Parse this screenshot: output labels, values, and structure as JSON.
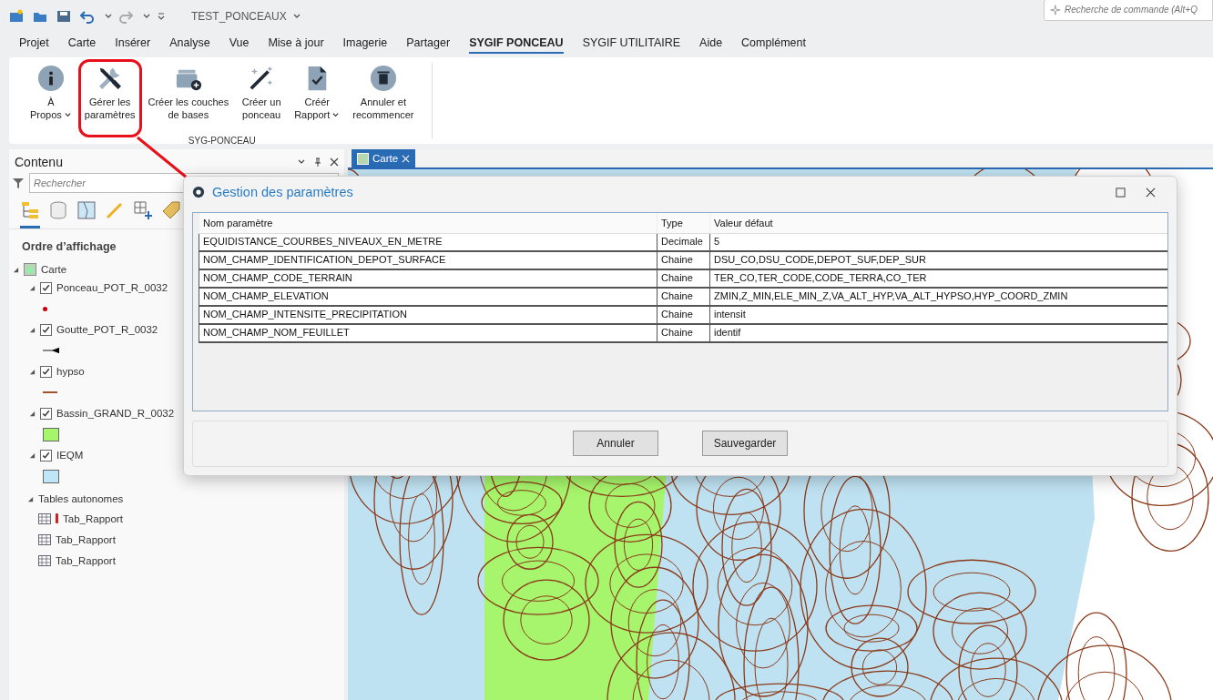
{
  "quick_access": {
    "project_title": "TEST_PONCEAUX",
    "command_search": {
      "placeholder": "Recherche de commande (Alt+Q"
    }
  },
  "menu_tabs": [
    {
      "label": "Projet",
      "selected": false
    },
    {
      "label": "Carte",
      "selected": false
    },
    {
      "label": "Insérer",
      "selected": false
    },
    {
      "label": "Analyse",
      "selected": false
    },
    {
      "label": "Vue",
      "selected": false
    },
    {
      "label": "Mise à jour",
      "selected": false
    },
    {
      "label": "Imagerie",
      "selected": false
    },
    {
      "label": "Partager",
      "selected": false
    },
    {
      "label": "SYGIF PONCEAU",
      "selected": true
    },
    {
      "label": "SYGIF UTILITAIRE",
      "selected": false
    },
    {
      "label": "Aide",
      "selected": false
    },
    {
      "label": "Complément",
      "selected": false
    }
  ],
  "ribbon": {
    "group_label": "SYG-PONCEAU",
    "buttons": [
      {
        "kind": "info",
        "lines": [
          "À",
          "Propos"
        ],
        "dropdown": true,
        "highlighted": false
      },
      {
        "kind": "tools",
        "lines": [
          "Gérer les",
          "paramètres"
        ],
        "dropdown": false,
        "highlighted": true
      },
      {
        "kind": "layers",
        "lines": [
          "Créer les couches",
          "de bases"
        ],
        "dropdown": false,
        "highlighted": false
      },
      {
        "kind": "wand",
        "lines": [
          "Créer un",
          "ponceau"
        ],
        "dropdown": false,
        "highlighted": false
      },
      {
        "kind": "report",
        "lines": [
          "Créér",
          "Rapport"
        ],
        "dropdown": true,
        "highlighted": false
      },
      {
        "kind": "trash",
        "lines": [
          "Annuler et",
          "recommencer"
        ],
        "dropdown": false,
        "highlighted": false
      }
    ]
  },
  "contents_pane": {
    "title": "Contenu",
    "search": {
      "placeholder": "Rechercher"
    },
    "section": "Ordre d’affichage",
    "map": {
      "label": "Carte",
      "expanded": true,
      "children": [
        {
          "label": "Ponceau_POT_R_0032",
          "checked": true,
          "expanded": true,
          "kind": "point",
          "color": "#cc0000"
        },
        {
          "label": "Goutte_POT_R_0032",
          "checked": true,
          "expanded": true,
          "kind": "arrow",
          "color": "#000000"
        },
        {
          "label": "hypso",
          "checked": true,
          "expanded": true,
          "kind": "line",
          "color": "#a0522d"
        },
        {
          "label": "Bassin_GRAND_R_0032",
          "checked": true,
          "expanded": true,
          "kind": "fill",
          "color": "#a6f56c"
        },
        {
          "label": "IEQM",
          "checked": true,
          "expanded": true,
          "kind": "fill",
          "color": "#bfe6f7"
        }
      ]
    },
    "tables": {
      "label": "Tables autonomes",
      "expanded": true,
      "children": [
        {
          "label": "Tab_Rapport",
          "warning": true
        },
        {
          "label": "Tab_Rapport",
          "warning": false
        },
        {
          "label": "Tab_Rapport",
          "warning": false
        }
      ]
    }
  },
  "map_view": {
    "tab": {
      "label": "Carte",
      "selected": true
    }
  },
  "dialog": {
    "title": "Gestion des paramètres",
    "columns": [
      "Nom paramètre",
      "Type",
      "Valeur défaut"
    ],
    "rows": [
      [
        "EQUIDISTANCE_COURBES_NIVEAUX_EN_METRE",
        "Decimale",
        "5"
      ],
      [
        "NOM_CHAMP_IDENTIFICATION_DEPOT_SURFACE",
        "Chaine",
        "DSU_CO,DSU_CODE,DEPOT_SUF,DEP_SUR"
      ],
      [
        "NOM_CHAMP_CODE_TERRAIN",
        "Chaine",
        "TER_CO,TER_CODE,CODE_TERRA,CO_TER"
      ],
      [
        "NOM_CHAMP_ELEVATION",
        "Chaine",
        "ZMIN,Z_MIN,ELE_MIN_Z,VA_ALT_HYP,VA_ALT_HYPSO,HYP_COORD_ZMIN"
      ],
      [
        "NOM_CHAMP_INTENSITE_PRECIPITATION",
        "Chaine",
        "intensit"
      ],
      [
        "NOM_CHAMP_NOM_FEUILLET",
        "Chaine",
        "identif"
      ]
    ],
    "buttons": [
      "Annuler",
      "Sauvegarder"
    ]
  }
}
